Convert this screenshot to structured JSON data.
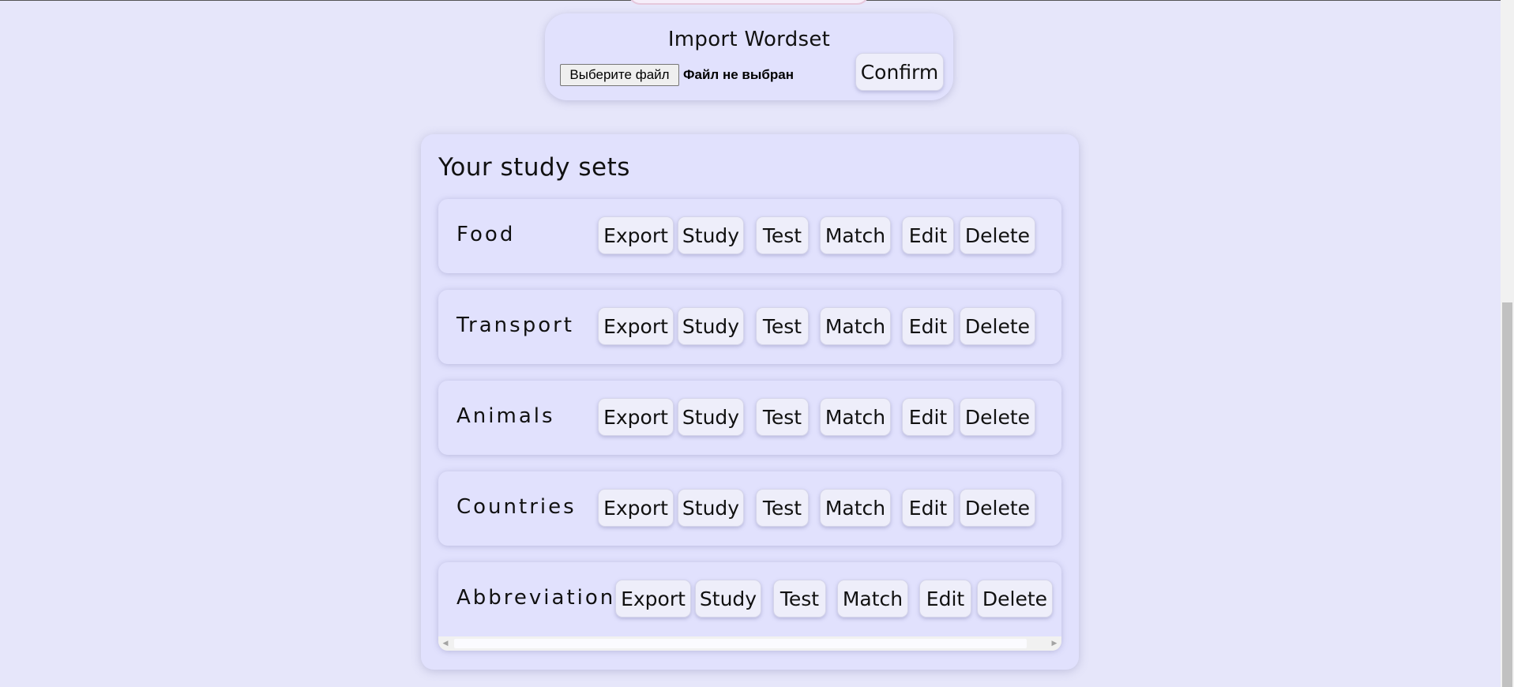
{
  "import": {
    "title": "Import Wordset",
    "file_button_label": "Выберите файл",
    "file_status": "Файл не выбран",
    "confirm_label": "Confirm"
  },
  "study_sets": {
    "title": "Your study sets",
    "actions": {
      "export": "Export",
      "study": "Study",
      "test": "Test",
      "match": "Match",
      "edit": "Edit",
      "delete": "Delete"
    },
    "items": [
      {
        "name": "Food"
      },
      {
        "name": "Transport"
      },
      {
        "name": "Animals"
      },
      {
        "name": "Countries"
      },
      {
        "name": "Abbreviations"
      }
    ]
  },
  "colors": {
    "background": "#e6e6fa",
    "card": "#e1e1fd",
    "button": "#eeeefa"
  }
}
